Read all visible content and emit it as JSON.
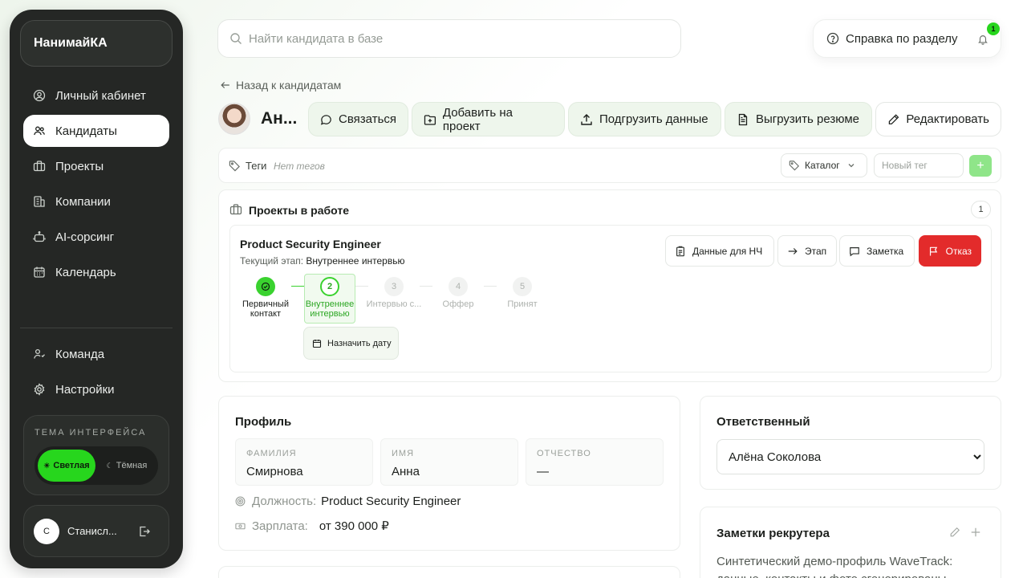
{
  "sidebar": {
    "brand": "НанимайКА",
    "items": [
      {
        "label": "Личный кабинет",
        "icon": "user-circle-icon"
      },
      {
        "label": "Кандидаты",
        "icon": "users-icon",
        "active": true
      },
      {
        "label": "Проекты",
        "icon": "briefcase-icon"
      },
      {
        "label": "Компании",
        "icon": "building-icon"
      },
      {
        "label": "AI-сорсинг",
        "icon": "robot-icon"
      },
      {
        "label": "Календарь",
        "icon": "calendar-icon"
      }
    ],
    "bottom_items": [
      {
        "label": "Команда",
        "icon": "team-icon"
      },
      {
        "label": "Настройки",
        "icon": "gear-icon"
      }
    ],
    "theme": {
      "title": "ТЕМА ИНТЕРФЕЙСА",
      "light_label": "Светлая",
      "dark_label": "Тёмная",
      "selected": "light"
    },
    "user": {
      "initial": "С",
      "name": "Станисл..."
    }
  },
  "search": {
    "placeholder": "Найти кандидата в базе"
  },
  "help": {
    "label": "Справка по разделу",
    "notifications": "1"
  },
  "back": {
    "label": "Назад к кандидатам"
  },
  "candidate": {
    "name": "Ан...",
    "actions": {
      "contact": "Связаться",
      "add_project": "Добавить на проект",
      "upload": "Подгрузить данные",
      "export": "Выгрузить резюме",
      "edit": "Редактировать"
    }
  },
  "tags": {
    "label": "Теги",
    "empty": "Нет тегов",
    "catalog": "Каталог",
    "new_placeholder": "Новый тег",
    "add": "+"
  },
  "projects": {
    "title": "Проекты в работе",
    "count": "1",
    "card": {
      "title": "Product Security Engineer",
      "stage_prefix": "Текущий этап:",
      "stage": "Внутреннее интервью",
      "buttons": {
        "data": "Данные для НЧ",
        "stage": "Этап",
        "note": "Заметка",
        "reject": "Отказ"
      },
      "steps": [
        {
          "num": "",
          "label": "Первичный контакт",
          "state": "done"
        },
        {
          "num": "2",
          "label": "Внутреннее интервью",
          "state": "current"
        },
        {
          "num": "3",
          "label": "Интервью с...",
          "state": "next"
        },
        {
          "num": "4",
          "label": "Оффер",
          "state": "next"
        },
        {
          "num": "5",
          "label": "Принят",
          "state": "next"
        }
      ],
      "schedule": "Назначить дату"
    }
  },
  "profile": {
    "title": "Профиль",
    "fields": [
      {
        "key": "ФАМИЛИЯ",
        "value": "Смирнова"
      },
      {
        "key": "ИМЯ",
        "value": "Анна"
      },
      {
        "key": "ОТЧЕСТВО",
        "value": "—"
      }
    ],
    "position_label": "Должность:",
    "position": "Product Security Engineer",
    "salary_label": "Зарплата:",
    "salary": "от 390 000 ₽"
  },
  "responsible": {
    "title": "Ответственный",
    "value": "Алёна Соколова"
  },
  "notes": {
    "title": "Заметки рекрутера",
    "text": "Синтетический демо-профиль WaveTrack: данные, контакты и фото сгенерированы"
  },
  "colors": {
    "accent": "#27d61d",
    "sidebar_bg": "#252725",
    "reject": "#e32b2b"
  }
}
